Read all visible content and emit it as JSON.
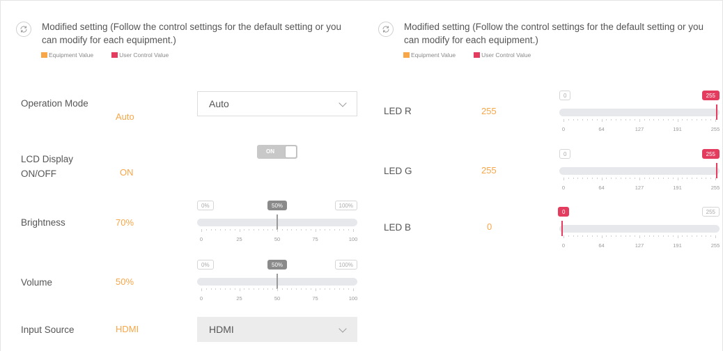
{
  "colors": {
    "equipment": "#f7a648",
    "user_control": "#e33c5e"
  },
  "left_panel": {
    "notice_icon": "sync-icon",
    "notice": "Modified setting (Follow the control settings for the default setting or you can modify for each equipment.)",
    "legend": {
      "equipment": "Equipment Value",
      "user": "User Control Value"
    },
    "rows": {
      "operation_mode": {
        "label": "Operation Mode",
        "value": "Auto",
        "control": "Auto"
      },
      "lcd_display": {
        "label": "LCD Display ON/OFF",
        "value": "ON",
        "toggle": "ON"
      },
      "brightness": {
        "label": "Brightness",
        "value": "70%",
        "min_label": "0%",
        "max_label": "100%",
        "current_label": "50%",
        "current": 50,
        "ticks": [
          "0",
          "25",
          "50",
          "75",
          "100"
        ]
      },
      "volume": {
        "label": "Volume",
        "value": "50%",
        "min_label": "0%",
        "max_label": "100%",
        "current_label": "50%",
        "current": 50,
        "ticks": [
          "0",
          "25",
          "50",
          "75",
          "100"
        ]
      },
      "input_source": {
        "label": "Input Source",
        "value": "HDMI",
        "control": "HDMI"
      }
    }
  },
  "right_panel": {
    "notice_icon": "sync-icon",
    "notice": "Modified setting (Follow the control settings for the default setting or you can modify for each equipment.)",
    "legend": {
      "equipment": "Equipment Value",
      "user": "User Control Value"
    },
    "rows": {
      "led_r": {
        "label": "LED R",
        "value": "255",
        "min_label": "0",
        "max_label": "255",
        "current": 255,
        "ticks": [
          "0",
          "64",
          "127",
          "191",
          "255"
        ]
      },
      "led_g": {
        "label": "LED G",
        "value": "255",
        "min_label": "0",
        "max_label": "255",
        "current": 255,
        "ticks": [
          "0",
          "64",
          "127",
          "191",
          "255"
        ]
      },
      "led_b": {
        "label": "LED B",
        "value": "0",
        "min_label": "0",
        "max_label": "255",
        "current": 0,
        "ticks": [
          "0",
          "64",
          "127",
          "191",
          "255"
        ]
      }
    }
  }
}
